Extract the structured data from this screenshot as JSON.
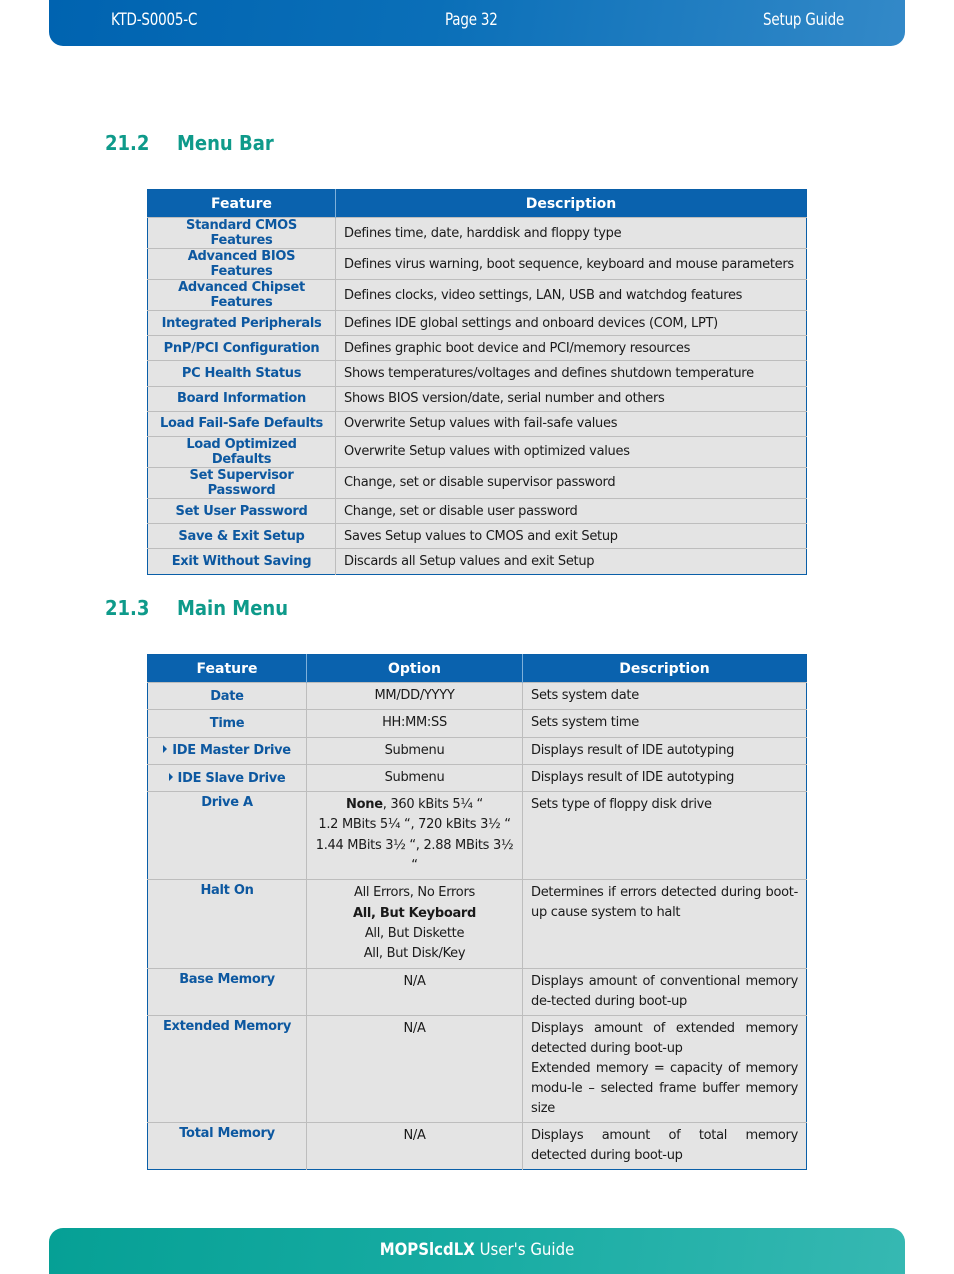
{
  "header": {
    "doc_id": "KTD-S0005-C",
    "page": "Page 32",
    "section": "Setup Guide"
  },
  "sections": [
    {
      "number": "21.2",
      "title": "Menu Bar"
    },
    {
      "number": "21.3",
      "title": "Main Menu"
    }
  ],
  "menu_bar_table": {
    "columns": [
      "Feature",
      "Description"
    ],
    "rows": [
      {
        "feature": "Standard CMOS Features",
        "description": "Defines time, date, harddisk and floppy type"
      },
      {
        "feature": "Advanced BIOS Features",
        "description": "Defines virus warning, boot sequence, keyboard and mouse parameters"
      },
      {
        "feature": "Advanced Chipset Features",
        "description": "Defines clocks, video settings, LAN, USB and watchdog features"
      },
      {
        "feature": "Integrated Peripherals",
        "description": "Defines IDE global settings and onboard devices (COM, LPT)"
      },
      {
        "feature": "PnP/PCI Configuration",
        "description": "Defines graphic boot device and PCI/memory resources"
      },
      {
        "feature": "PC Health Status",
        "description": "Shows temperatures/voltages and defines shutdown temperature"
      },
      {
        "feature": "Board Information",
        "description": "Shows BIOS version/date, serial number and others"
      },
      {
        "feature": "Load Fail-Safe Defaults",
        "description": "Overwrite Setup values with fail-safe values"
      },
      {
        "feature": "Load Optimized Defaults",
        "description": "Overwrite Setup values with optimized values"
      },
      {
        "feature": "Set Supervisor Password",
        "description": "Change, set or disable supervisor password"
      },
      {
        "feature": "Set User Password",
        "description": "Change, set or disable user password"
      },
      {
        "feature": "Save & Exit Setup",
        "description": "Saves Setup values to CMOS and exit Setup"
      },
      {
        "feature": "Exit Without Saving",
        "description": "Discards all Setup values and exit Setup"
      }
    ]
  },
  "main_menu_table": {
    "columns": [
      "Feature",
      "Option",
      "Description"
    ],
    "rows": [
      {
        "feature": "Date",
        "options": [
          "MM/DD/YYYY"
        ],
        "description": [
          "Sets system date"
        ]
      },
      {
        "feature": "Time",
        "options": [
          "HH:MM:SS"
        ],
        "description": [
          "Sets system time"
        ]
      },
      {
        "feature": "IDE Master Drive",
        "submenu_icon": "triangle-right-icon",
        "options": [
          "Submenu"
        ],
        "description": [
          "Displays result of IDE autotyping"
        ]
      },
      {
        "feature": "IDE Slave Drive",
        "submenu_icon": "triangle-right-icon",
        "options": [
          "Submenu"
        ],
        "description": [
          "Displays result of IDE autotyping"
        ]
      },
      {
        "feature": "Drive A",
        "options_bold_prefix": "None",
        "options": [
          ", 360 kBits 5¼ “",
          "1.2 MBits 5¼ “, 720 kBits 3½ “",
          "1.44 MBits 3½ “, 2.88 MBits 3½ “"
        ],
        "description": [
          "Sets type of floppy disk drive"
        ]
      },
      {
        "feature": "Halt On",
        "options": [
          "All Errors, No Errors",
          "All, But Keyboard",
          "All, But Diskette",
          "All, But Disk/Key"
        ],
        "default_option": "All, But Keyboard",
        "description": [
          "Determines if errors detected during boot-up cause system to halt"
        ]
      },
      {
        "feature": "Base Memory",
        "options": [
          "N/A"
        ],
        "description": [
          "Displays amount of conventional memory de-tected during boot-up"
        ]
      },
      {
        "feature": "Extended Memory",
        "options": [
          "N/A"
        ],
        "description": [
          "Displays amount of extended memory detected during boot-up",
          "Extended memory = capacity of memory modu-le – selected frame buffer memory size"
        ]
      },
      {
        "feature": "Total Memory",
        "options": [
          "N/A"
        ],
        "description": [
          "Displays amount of total memory detected during boot-up"
        ]
      }
    ]
  },
  "footer": {
    "product": "MOPSlcdLX",
    "suffix": " User's Guide"
  },
  "colors": {
    "header_blue": "#0063b0",
    "footer_teal": "#06a095",
    "section_title": "#0e9a8a",
    "feature_text": "#0d58a0",
    "table_header": "#0a62ae",
    "table_row_bg": "#e4e4e4"
  }
}
